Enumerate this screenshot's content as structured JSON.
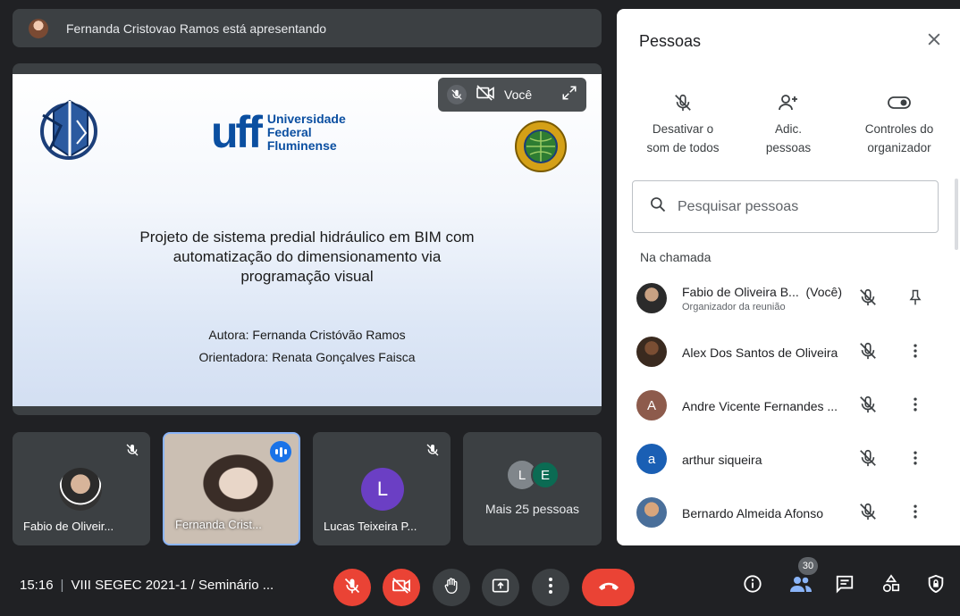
{
  "banner": {
    "text": "Fernanda Cristovao Ramos está apresentando"
  },
  "slide": {
    "uff_mark": "uff",
    "uff_name": [
      "Universidade",
      "Federal",
      "Fluminense"
    ],
    "title_lines": [
      "Projeto de sistema predial hidráulico em BIM com",
      "automatização do dimensionamento via",
      "programação visual"
    ],
    "author": "Autora: Fernanda Cristóvão Ramos",
    "advisor": "Orientadora: Renata Gonçalves Faisca",
    "self_label": "Você"
  },
  "tiles": [
    {
      "name": "Fabio de Oliveir...",
      "muted": true
    },
    {
      "name": "Fernanda Crist...",
      "speaking": true
    },
    {
      "name": "Lucas Teixeira P...",
      "initial": "L",
      "muted": true
    },
    {
      "more_label": "Mais 25 pessoas",
      "initials": [
        "L",
        "E"
      ]
    }
  ],
  "panel": {
    "title": "Pessoas",
    "actions": [
      {
        "label1": "Desativar o",
        "label2": "som de todos",
        "icon": "mic-off-icon"
      },
      {
        "label1": "Adic.",
        "label2": "pessoas",
        "icon": "person-add-icon"
      },
      {
        "label1": "Controles do",
        "label2": "organizador",
        "icon": "toggle-icon"
      }
    ],
    "search_placeholder": "Pesquisar pessoas",
    "section": "Na chamada",
    "people": [
      {
        "name": "Fabio de Oliveira B...",
        "you": "(Você)",
        "subtitle": "Organizador da reunião",
        "avatar": "photo",
        "action": "pin-icon"
      },
      {
        "name": "Alex Dos Santos de Oliveira",
        "avatar": "photo",
        "action": "more-icon"
      },
      {
        "name": "Andre Vicente Fernandes ...",
        "initial": "A",
        "color": "#8d5b4c",
        "action": "more-icon"
      },
      {
        "name": "arthur siqueira",
        "initial": "a",
        "color": "#1a5fb4",
        "action": "more-icon"
      },
      {
        "name": "Bernardo Almeida Afonso",
        "avatar": "photo",
        "action": "more-icon"
      }
    ]
  },
  "bottom": {
    "time": "15:16",
    "meeting": "VIII SEGEC 2021-1 / Seminário ...",
    "people_count": "30"
  }
}
